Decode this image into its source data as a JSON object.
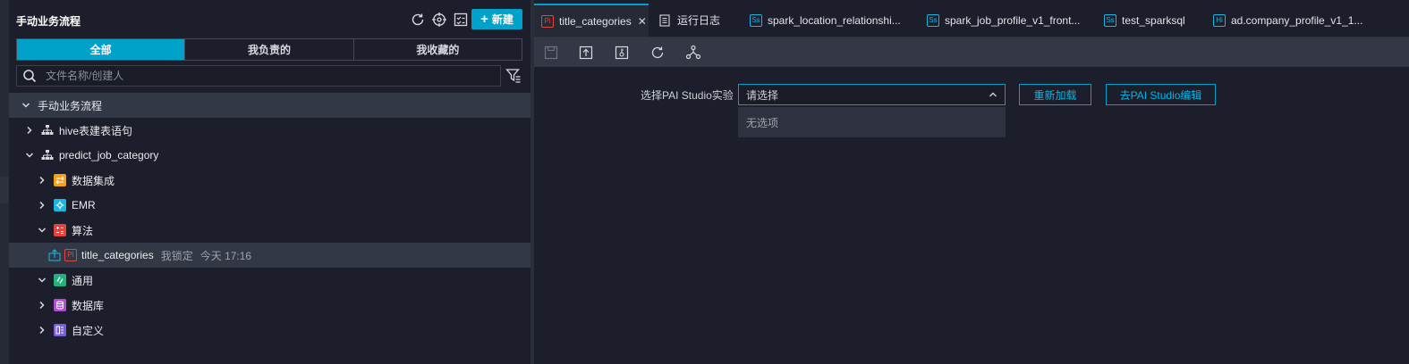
{
  "sidebar": {
    "title": "手动业务流程",
    "new_label": "新建",
    "segments": [
      "全部",
      "我负责的",
      "我收藏的"
    ],
    "search_placeholder": "文件名称/创建人",
    "tree": {
      "root": "手动业务流程",
      "n1": "hive表建表语句",
      "n2": "predict_job_category",
      "n3": "数据集成",
      "n4": "EMR",
      "n5": "算法",
      "n6_name": "title_categories",
      "n6_lock": "我锁定",
      "n6_time": "今天 17:16",
      "n7": "通用",
      "n8": "数据库",
      "n9": "自定义"
    }
  },
  "tabs": [
    {
      "badge": "Pi",
      "label": "title_categories"
    },
    {
      "badge": "",
      "label": "运行日志"
    },
    {
      "badge": "Ss",
      "label": "spark_location_relationshi..."
    },
    {
      "badge": "Ss",
      "label": "spark_job_profile_v1_front..."
    },
    {
      "badge": "Ss",
      "label": "test_sparksql"
    },
    {
      "badge": "Hi",
      "label": "ad.company_profile_v1_1..."
    }
  ],
  "form": {
    "label": "选择PAI Studio实验",
    "placeholder": "请选择",
    "no_option": "无选项",
    "reload_label": "重新加载",
    "edit_label": "去PAI Studio编辑"
  },
  "colors": {
    "accent": "#00a2ca",
    "pai_red": "#e0463c",
    "sparksql_cyan": "#19b6e0",
    "integration_orange": "#f4a01c",
    "emr_cyan": "#19b6e0",
    "algo_red": "#e8423b",
    "general_green": "#22b37a",
    "database_purple": "#b04fd6",
    "custom_purple": "#7c5be0"
  }
}
